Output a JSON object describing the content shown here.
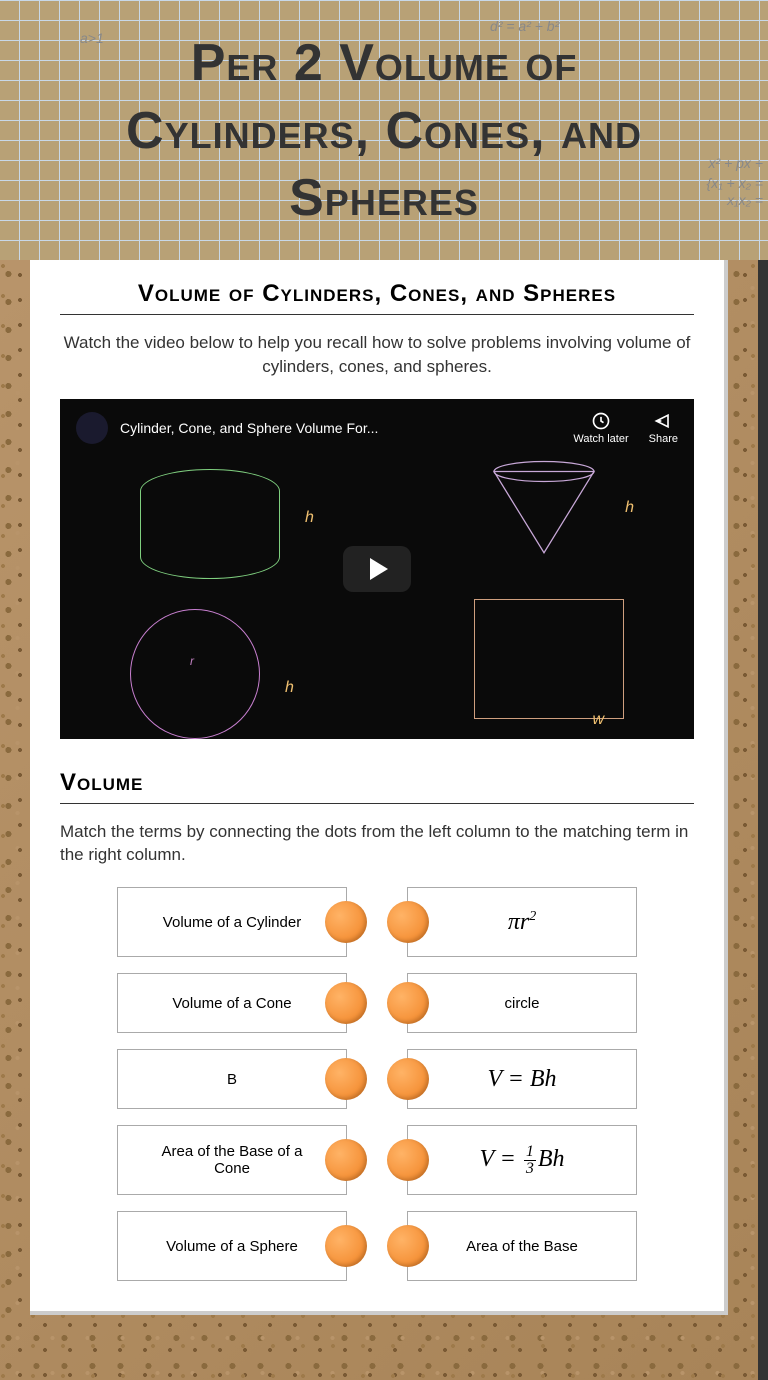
{
  "header": {
    "title": "Per 2 Volume of Cylinders, Cones, and Spheres",
    "doodles": {
      "agt": "a>1",
      "pyth": "d² = a² + b²",
      "quad": "x² + px +",
      "sum": "{x₁ + x₂ =",
      "prod": " x₁x₂ ="
    }
  },
  "section1": {
    "title": "Volume of Cylinders, Cones, and Spheres",
    "instruction": "Watch the video below to help you recall how to solve problems involving volume of cylinders, cones, and spheres.",
    "video": {
      "title": "Cylinder, Cone, and Sphere Volume For...",
      "watch_later": "Watch later",
      "share": "Share",
      "labels": {
        "h1": "h",
        "r": "r",
        "h2": "h",
        "h3": "h",
        "w": "w"
      }
    }
  },
  "section2": {
    "title": "Volume",
    "instruction": "Match the terms by connecting the dots from the left column to the matching term in the right column.",
    "left_items": [
      "Volume of a Cylinder",
      "Volume of a Cone",
      "B",
      "Area of the Base of a Cone",
      "Volume of a Sphere"
    ],
    "right_items": [
      {
        "type": "formula_pi_r2",
        "text": "πr²"
      },
      {
        "type": "text",
        "text": "circle"
      },
      {
        "type": "formula_vbh",
        "text": "V = Bh"
      },
      {
        "type": "formula_v13bh",
        "text": "V = ⅓Bh"
      },
      {
        "type": "text",
        "text": "Area of the Base"
      }
    ]
  }
}
